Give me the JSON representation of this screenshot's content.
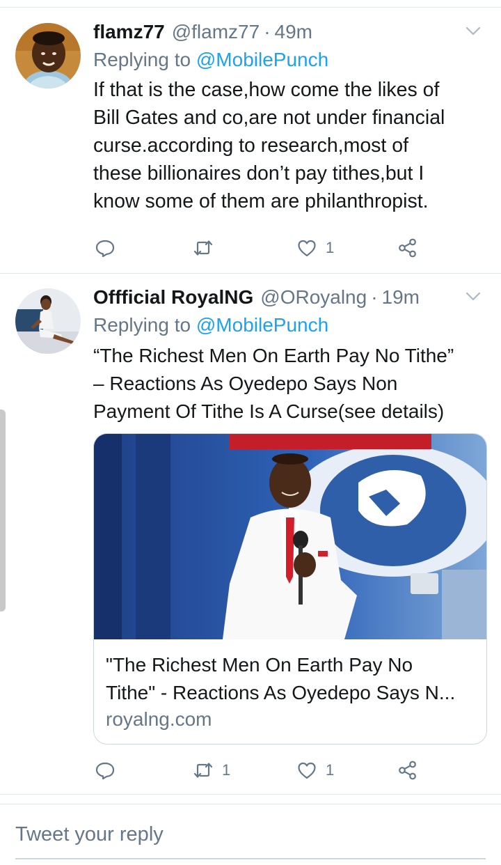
{
  "tweets": [
    {
      "name": "flamz77",
      "handle": "@flamz77",
      "separator": "·",
      "time": "49m",
      "replying_prefix": "Replying to ",
      "replying_to": "@MobilePunch",
      "text": "If that is the case,how come the likes of\nBill Gates and co,are not under financial\ncurse.according to research,most of\nthese billionaires don’t pay tithes,but I\nknow some of them are philanthropist.",
      "actions": {
        "reply_count": "",
        "retweet_count": "",
        "like_count": "1"
      }
    },
    {
      "name": "Offficial RoyalNG",
      "handle": "@ORoyalng",
      "separator": "·",
      "time": "19m",
      "replying_prefix": "Replying to ",
      "replying_to": "@MobilePunch",
      "text": "“The Richest Men On Earth Pay No Tithe”\n– Reactions As Oyedepo Says Non\nPayment Of Tithe Is A Curse(see details)",
      "card": {
        "title": "\"The Richest Men On Earth Pay No\nTithe\" - Reactions As Oyedepo Says N...",
        "domain": "royalng.com"
      },
      "actions": {
        "reply_count": "",
        "retweet_count": "1",
        "like_count": "1"
      }
    }
  ],
  "compose": {
    "placeholder": "Tweet your reply"
  },
  "icons": {
    "reply": "reply-icon",
    "retweet": "retweet-icon",
    "like": "heart-icon",
    "share": "share-icon",
    "caret": "chevron-down-icon"
  },
  "colors": {
    "accent": "#1da1f2",
    "muted": "#657786",
    "text": "#14171a",
    "divider": "#e1e8ed"
  }
}
